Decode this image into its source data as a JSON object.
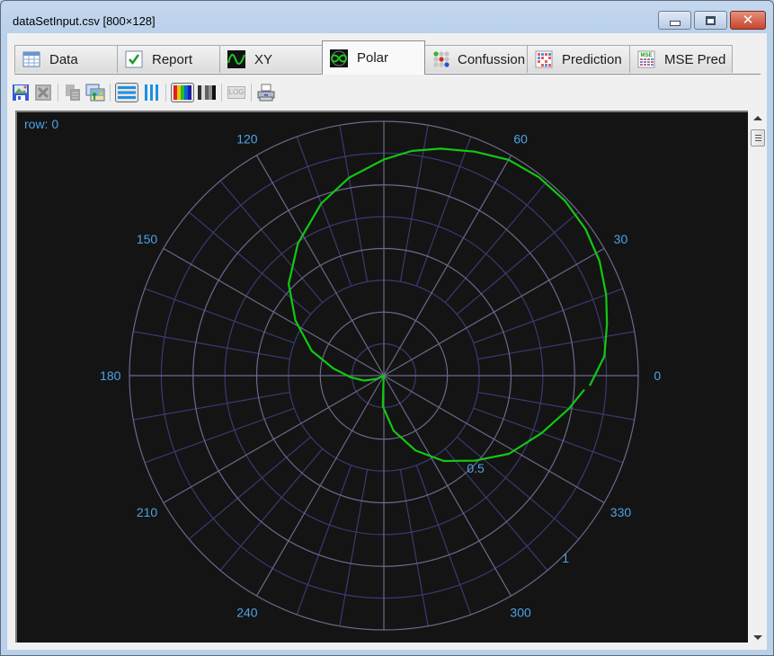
{
  "window": {
    "title": "dataSetInput.csv [800×128]",
    "buttons": [
      "minimize",
      "maximize",
      "close"
    ]
  },
  "tabs": [
    {
      "label": "Data",
      "icon": "table-icon",
      "active": false
    },
    {
      "label": "Report",
      "icon": "checkmark-icon",
      "active": false
    },
    {
      "label": "XY",
      "icon": "sine-wave-icon",
      "active": false
    },
    {
      "label": "Polar",
      "icon": "polar-infinity-icon",
      "active": true
    },
    {
      "label": "Confussion",
      "icon": "dot-matrix-icon",
      "active": false
    },
    {
      "label": "Prediction",
      "icon": "grid-chart-icon",
      "active": false
    },
    {
      "label": "MSE Pred",
      "icon": "mse-grid-icon",
      "active": false
    }
  ],
  "toolbar": [
    {
      "name": "save-image-button",
      "icon": "save-image-icon",
      "enabled": true
    },
    {
      "name": "export-excel-button",
      "icon": "excel-icon",
      "enabled": false
    },
    {
      "name": "copy-button",
      "icon": "copy-icon",
      "enabled": false
    },
    {
      "name": "images-button",
      "icon": "picture-icon",
      "enabled": true
    },
    {
      "name": "horizontal-lines-button",
      "icon": "horizontal-lines-icon",
      "enabled": true,
      "pressed": true
    },
    {
      "name": "vertical-lines-button",
      "icon": "vertical-lines-icon",
      "enabled": true
    },
    {
      "name": "color-palette-button",
      "icon": "rainbow-icon",
      "enabled": true,
      "pressed": true
    },
    {
      "name": "grayscale-palette-button",
      "icon": "grayscale-icon",
      "enabled": true
    },
    {
      "name": "log-scale-button",
      "icon": "log-icon",
      "enabled": false,
      "label": "LOG"
    },
    {
      "name": "print-button",
      "icon": "printer-icon",
      "enabled": true
    }
  ],
  "plot": {
    "row_label": "row: 0",
    "colors": {
      "background": "#141414",
      "curve": "#12c812",
      "labels": "#4ea2e6",
      "grid_major": "#6a6a8c",
      "grid_minor": "#3a3a72"
    }
  },
  "chart_data": {
    "type": "line",
    "coordinate_system": "polar",
    "title": "",
    "angle_unit": "degrees",
    "angle_ticks": [
      0,
      30,
      60,
      120,
      150,
      180,
      210,
      240,
      300,
      330
    ],
    "angle_tick_labels": [
      "0",
      "30",
      "60",
      "120",
      "150",
      "180",
      "210",
      "240",
      "300",
      "330"
    ],
    "radial_range": [
      0,
      1
    ],
    "radial_ticks": [
      0.5,
      1
    ],
    "radial_tick_labels": [
      "0.5",
      "1"
    ],
    "radial_gridlines": [
      0.125,
      0.25,
      0.375,
      0.5,
      0.625,
      0.75,
      0.875,
      1.0
    ],
    "major_angle_step": 30,
    "minor_angle_step": 10,
    "grid": true,
    "legend": "none",
    "series": [
      {
        "name": "row 0",
        "points": [
          {
            "theta": -2.8,
            "r": 0.81
          },
          {
            "theta": 5,
            "r": 0.87
          },
          {
            "theta": 13,
            "r": 0.9
          },
          {
            "theta": 20,
            "r": 0.93
          },
          {
            "theta": 28,
            "r": 0.96
          },
          {
            "theta": 36,
            "r": 0.98
          },
          {
            "theta": 44,
            "r": 0.99
          },
          {
            "theta": 52,
            "r": 0.99
          },
          {
            "theta": 60,
            "r": 0.98
          },
          {
            "theta": 68,
            "r": 0.95
          },
          {
            "theta": 76,
            "r": 0.92
          },
          {
            "theta": 83,
            "r": 0.89
          },
          {
            "theta": 90,
            "r": 0.85
          },
          {
            "theta": 100,
            "r": 0.79
          },
          {
            "theta": 110,
            "r": 0.72
          },
          {
            "theta": 123,
            "r": 0.62
          },
          {
            "theta": 136,
            "r": 0.52
          },
          {
            "theta": 148,
            "r": 0.41
          },
          {
            "theta": 161,
            "r": 0.3
          },
          {
            "theta": 172,
            "r": 0.2
          },
          {
            "theta": 183,
            "r": 0.13
          },
          {
            "theta": 194,
            "r": 0.08
          },
          {
            "theta": 205,
            "r": 0.03
          },
          {
            "theta": 215,
            "r": 0.0
          },
          {
            "theta": 266,
            "r": 0.02
          },
          {
            "theta": 268,
            "r": 0.12
          },
          {
            "theta": 280,
            "r": 0.22
          },
          {
            "theta": 293,
            "r": 0.32
          },
          {
            "theta": 305,
            "r": 0.41
          },
          {
            "theta": 317,
            "r": 0.49
          },
          {
            "theta": 328,
            "r": 0.58
          },
          {
            "theta": 340,
            "r": 0.66
          },
          {
            "theta": 350,
            "r": 0.74
          },
          {
            "theta": 356,
            "r": 0.79
          }
        ]
      }
    ]
  }
}
